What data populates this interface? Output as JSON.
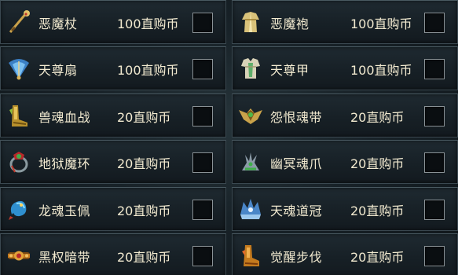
{
  "items": [
    {
      "name": "恶魔杖",
      "price": "100直购币",
      "icon": "demon-staff-icon",
      "checked": false
    },
    {
      "name": "恶魔袍",
      "price": "100直购币",
      "icon": "demon-robe-icon",
      "checked": false
    },
    {
      "name": "天尊扇",
      "price": "100直购币",
      "icon": "celestial-fan-icon",
      "checked": false
    },
    {
      "name": "天尊甲",
      "price": "100直购币",
      "icon": "celestial-armor-icon",
      "checked": false
    },
    {
      "name": "兽魂血战",
      "price": "20直购币",
      "icon": "beast-soul-boots-icon",
      "checked": false
    },
    {
      "name": "怨恨魂带",
      "price": "20直购币",
      "icon": "grudge-soul-belt-icon",
      "checked": false
    },
    {
      "name": "地狱魔环",
      "price": "20直购币",
      "icon": "hell-demon-ring-icon",
      "checked": false
    },
    {
      "name": "幽冥魂爪",
      "price": "20直购币",
      "icon": "nether-soul-claw-icon",
      "checked": false
    },
    {
      "name": "龙魂玉佩",
      "price": "20直购币",
      "icon": "dragon-soul-pendant-icon",
      "checked": false
    },
    {
      "name": "天魂道冠",
      "price": "20直购币",
      "icon": "heaven-soul-crown-icon",
      "checked": false
    },
    {
      "name": "黑权暗带",
      "price": "20直购币",
      "icon": "dark-power-belt-icon",
      "checked": false
    },
    {
      "name": "觉醒步伐",
      "price": "20直购币",
      "icon": "awakening-boots-icon",
      "checked": false
    }
  ]
}
